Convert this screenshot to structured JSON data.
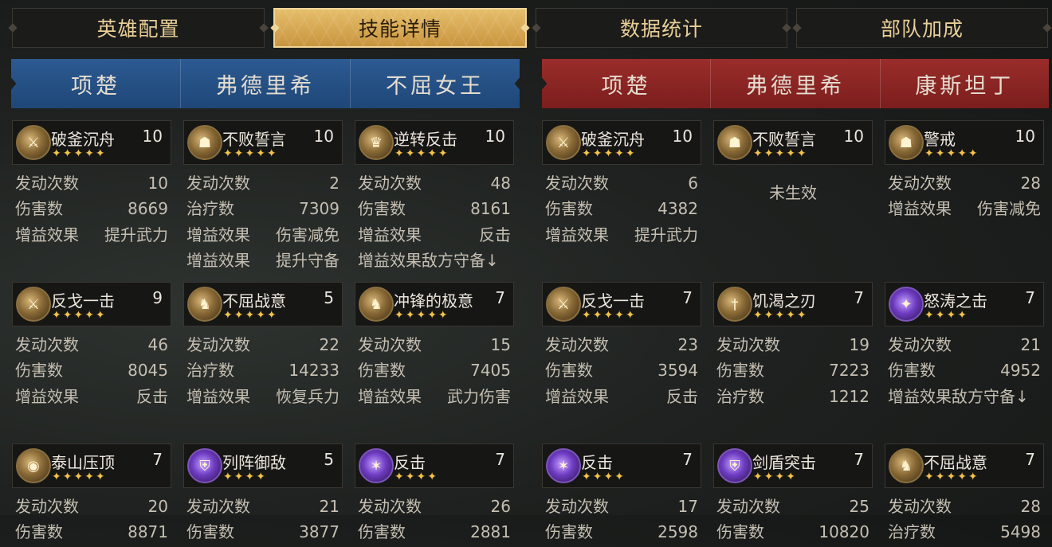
{
  "tabs": [
    {
      "label": "英雄配置",
      "active": false
    },
    {
      "label": "技能详情",
      "active": true
    },
    {
      "label": "数据统计",
      "active": false
    },
    {
      "label": "部队加成",
      "active": false
    }
  ],
  "colors": {
    "ally_team": "#245083",
    "enemy_team": "#8a2625",
    "accent": "#e5bd6a",
    "star": "#f3c24b"
  },
  "teams": [
    {
      "side": "ally",
      "heroes": [
        {
          "name": "项楚",
          "skills": [
            {
              "name": "破釜沉舟",
              "level": "10",
              "stars": "✦✦✦✦✦",
              "icon": "fire-sword-icon",
              "stats": [
                {
                  "label": "发动次数",
                  "value": "10"
                },
                {
                  "label": "伤害数",
                  "value": "8669"
                },
                {
                  "label": "增益效果",
                  "value": "提升武力"
                }
              ]
            },
            {
              "name": "反戈一击",
              "level": "9",
              "stars": "✦✦✦✦✦",
              "icon": "counter-strike-icon",
              "stats": [
                {
                  "label": "发动次数",
                  "value": "46"
                },
                {
                  "label": "伤害数",
                  "value": "8045"
                },
                {
                  "label": "增益效果",
                  "value": "反击"
                }
              ]
            },
            {
              "name": "泰山压顶",
              "level": "7",
              "stars": "✦✦✦✦✦",
              "icon": "mountain-crush-icon",
              "stats": [
                {
                  "label": "发动次数",
                  "value": "20"
                },
                {
                  "label": "伤害数",
                  "value": "8871"
                }
              ]
            }
          ]
        },
        {
          "name": "弗德里希",
          "skills": [
            {
              "name": "不败誓言",
              "level": "10",
              "stars": "✦✦✦✦✦",
              "icon": "oath-warrior-icon",
              "stats": [
                {
                  "label": "发动次数",
                  "value": "2"
                },
                {
                  "label": "治疗数",
                  "value": "7309"
                },
                {
                  "label": "增益效果",
                  "value": "伤害减免"
                },
                {
                  "label": "增益效果",
                  "value": "提升守备"
                }
              ]
            },
            {
              "name": "不屈战意",
              "level": "5",
              "stars": "✦✦✦✦✦",
              "icon": "cavalry-charge-icon",
              "stats": [
                {
                  "label": "发动次数",
                  "value": "22"
                },
                {
                  "label": "治疗数",
                  "value": "14233"
                },
                {
                  "label": "增益效果",
                  "value": "恢复兵力"
                }
              ]
            },
            {
              "name": "列阵御敌",
              "level": "5",
              "stars": "✦✦✦✦",
              "icon": "shield-formation-icon",
              "stats": [
                {
                  "label": "发动次数",
                  "value": "21"
                },
                {
                  "label": "伤害数",
                  "value": "3877"
                }
              ]
            }
          ]
        },
        {
          "name": "不屈女王",
          "skills": [
            {
              "name": "逆转反击",
              "level": "10",
              "stars": "✦✦✦✦✦",
              "icon": "winged-queen-icon",
              "stats": [
                {
                  "label": "发动次数",
                  "value": "48"
                },
                {
                  "label": "伤害数",
                  "value": "8161"
                },
                {
                  "label": "增益效果",
                  "value": "反击"
                },
                {
                  "label": "增益效果敌方守备↓",
                  "value": ""
                }
              ]
            },
            {
              "name": "冲锋的极意",
              "level": "7",
              "stars": "✦✦✦✦✦",
              "icon": "charging-horse-icon",
              "stats": [
                {
                  "label": "发动次数",
                  "value": "15"
                },
                {
                  "label": "伤害数",
                  "value": "7405"
                },
                {
                  "label": "增益效果",
                  "value": "武力伤害"
                }
              ]
            },
            {
              "name": "反击",
              "level": "7",
              "stars": "✦✦✦✦",
              "icon": "purple-counter-icon",
              "stats": [
                {
                  "label": "发动次数",
                  "value": "26"
                },
                {
                  "label": "伤害数",
                  "value": "2881"
                }
              ]
            }
          ]
        }
      ]
    },
    {
      "side": "enemy",
      "heroes": [
        {
          "name": "项楚",
          "skills": [
            {
              "name": "破釜沉舟",
              "level": "10",
              "stars": "✦✦✦✦✦",
              "icon": "fire-sword-icon",
              "stats": [
                {
                  "label": "发动次数",
                  "value": "6"
                },
                {
                  "label": "伤害数",
                  "value": "4382"
                },
                {
                  "label": "增益效果",
                  "value": "提升武力"
                }
              ]
            },
            {
              "name": "反戈一击",
              "level": "7",
              "stars": "✦✦✦✦✦",
              "icon": "counter-strike-icon",
              "stats": [
                {
                  "label": "发动次数",
                  "value": "23"
                },
                {
                  "label": "伤害数",
                  "value": "3594"
                },
                {
                  "label": "增益效果",
                  "value": "反击"
                }
              ]
            },
            {
              "name": "反击",
              "level": "7",
              "stars": "✦✦✦✦",
              "icon": "purple-counter-icon",
              "stats": [
                {
                  "label": "发动次数",
                  "value": "17"
                },
                {
                  "label": "伤害数",
                  "value": "2598"
                }
              ]
            }
          ]
        },
        {
          "name": "弗德里希",
          "skills": [
            {
              "name": "不败誓言",
              "level": "10",
              "stars": "✦✦✦✦✦",
              "icon": "oath-warrior-icon",
              "inactive": "未生效",
              "stats": []
            },
            {
              "name": "饥渴之刃",
              "level": "7",
              "stars": "✦✦✦✦✦",
              "icon": "thirst-blade-icon",
              "stats": [
                {
                  "label": "发动次数",
                  "value": "19"
                },
                {
                  "label": "伤害数",
                  "value": "7223"
                },
                {
                  "label": "治疗数",
                  "value": "1212"
                }
              ]
            },
            {
              "name": "剑盾突击",
              "level": "7",
              "stars": "✦✦✦✦",
              "icon": "sword-shield-icon",
              "stats": [
                {
                  "label": "发动次数",
                  "value": "25"
                },
                {
                  "label": "伤害数",
                  "value": "10820"
                }
              ]
            }
          ]
        },
        {
          "name": "康斯坦丁",
          "skills": [
            {
              "name": "警戒",
              "level": "10",
              "stars": "✦✦✦✦✦",
              "icon": "sentry-icon",
              "stats": [
                {
                  "label": "发动次数",
                  "value": "28"
                },
                {
                  "label": "增益效果",
                  "value": "伤害减免"
                }
              ]
            },
            {
              "name": "怒涛之击",
              "level": "7",
              "stars": "✦✦✦✦",
              "icon": "raging-wave-icon",
              "stats": [
                {
                  "label": "发动次数",
                  "value": "21"
                },
                {
                  "label": "伤害数",
                  "value": "4952"
                },
                {
                  "label": "增益效果敌方守备↓",
                  "value": ""
                }
              ]
            },
            {
              "name": "不屈战意",
              "level": "7",
              "stars": "✦✦✦✦✦",
              "icon": "cavalry-charge-icon",
              "stats": [
                {
                  "label": "发动次数",
                  "value": "28"
                },
                {
                  "label": "治疗数",
                  "value": "5498"
                }
              ]
            }
          ]
        }
      ]
    }
  ]
}
